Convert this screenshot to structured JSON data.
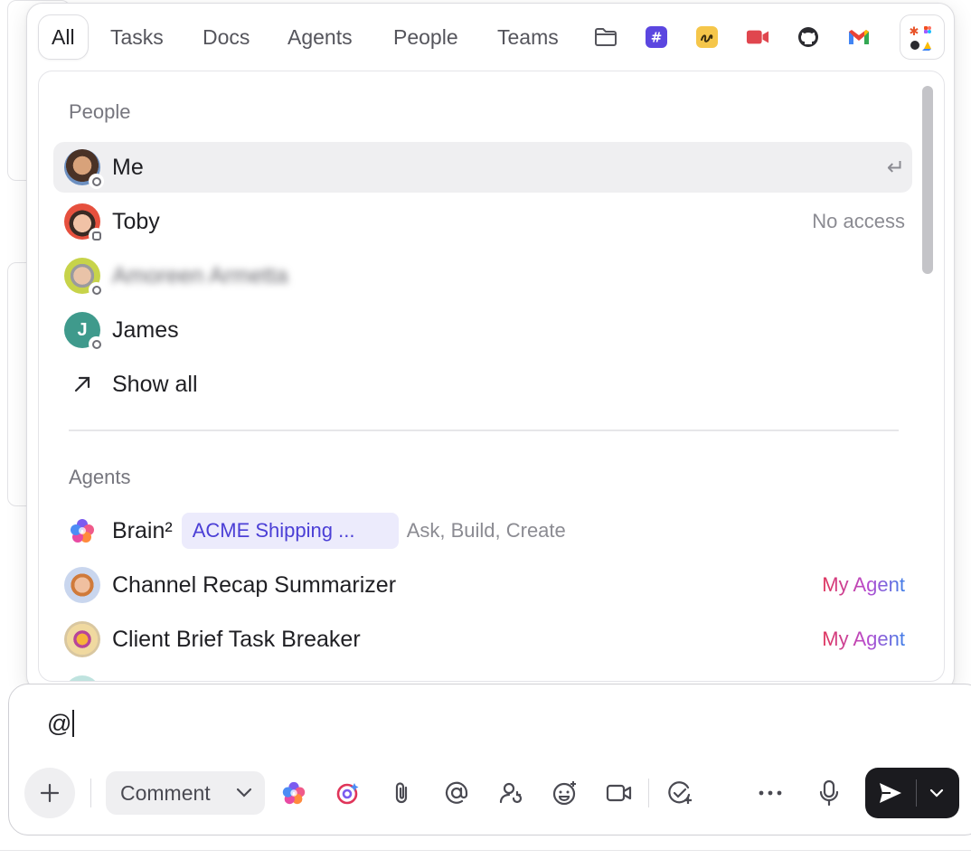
{
  "tabs": [
    {
      "label": "All",
      "active": true
    },
    {
      "label": "Tasks"
    },
    {
      "label": "Docs"
    },
    {
      "label": "Agents"
    },
    {
      "label": "People"
    },
    {
      "label": "Teams"
    }
  ],
  "tab_icons": [
    "folder-icon",
    "channel-hash-icon",
    "clip-icon",
    "video-icon",
    "github-icon",
    "gmail-icon",
    "apps-icon"
  ],
  "people": {
    "title": "People",
    "rows": [
      {
        "name": "Me",
        "right": "↵"
      },
      {
        "name": "Toby",
        "right": "No access"
      },
      {
        "name": "Amoreen Armetta"
      },
      {
        "name": "James",
        "initial": "J"
      },
      {
        "name": "Show all"
      }
    ]
  },
  "agents": {
    "title": "Agents",
    "rows": [
      {
        "name": "Brain²",
        "chip": "ACME Shipping ...",
        "desc": "Ask, Build, Create"
      },
      {
        "name": "Channel Recap Summarizer",
        "tag": "My Agent"
      },
      {
        "name": "Client Brief Task Breaker",
        "tag": "My Agent"
      }
    ]
  },
  "composer": {
    "text": "@",
    "comment_label": "Comment"
  },
  "colors": {
    "accent": "#4b3fd6",
    "chip_bg": "#ecebfc",
    "selected_row": "#efeff1",
    "send_bg": "#1b1b1f",
    "james_avatar": "#3f9a8c"
  }
}
